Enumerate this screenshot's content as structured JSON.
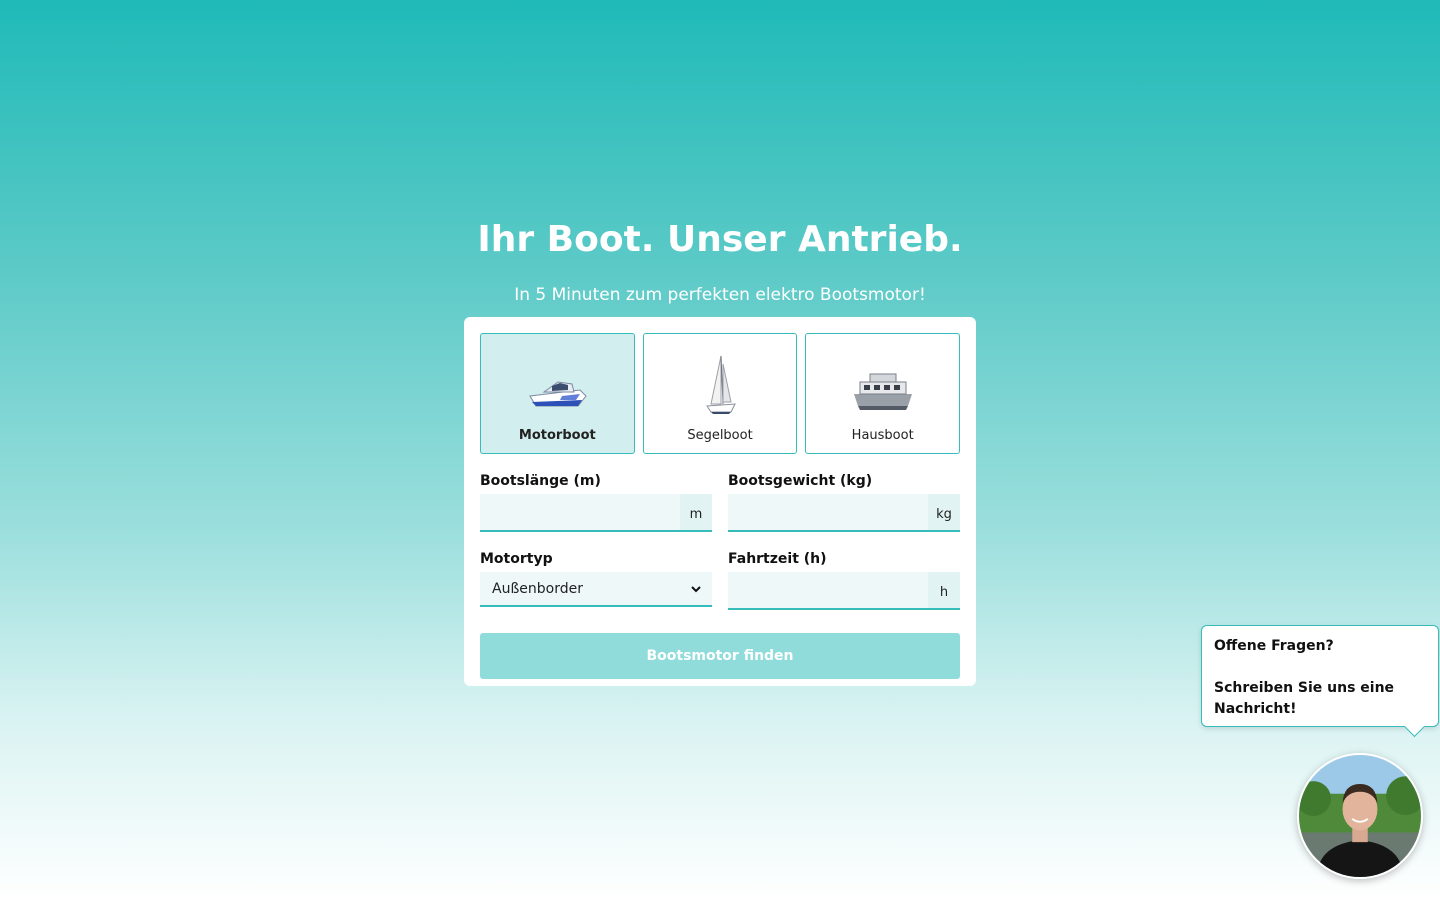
{
  "hero": {
    "title": "Ihr Boot. Unser Antrieb.",
    "subtitle": "In 5 Minuten zum perfekten elektro Bootsmotor!"
  },
  "boat_types": [
    {
      "label": "Motorboot",
      "selected": true,
      "icon": "motorboat-icon"
    },
    {
      "label": "Segelboot",
      "selected": false,
      "icon": "sailboat-icon"
    },
    {
      "label": "Hausboot",
      "selected": false,
      "icon": "houseboat-icon"
    }
  ],
  "form": {
    "length": {
      "label": "Bootslänge (m)",
      "value": "",
      "unit": "m"
    },
    "weight": {
      "label": "Bootsgewicht (kg)",
      "value": "",
      "unit": "kg"
    },
    "motor_type": {
      "label": "Motortyp",
      "selected": "Außenborder"
    },
    "duration": {
      "label": "Fahrtzeit (h)",
      "value": "",
      "unit": "h"
    },
    "submit_label": "Bootsmotor finden"
  },
  "chat": {
    "line1": "Offene Fragen?",
    "line2": "Schreiben Sie uns eine",
    "line3": "Nachricht!"
  },
  "colors": {
    "accent": "#36bcbb",
    "button": "#8fdcdb",
    "selected_bg": "#d3eeee"
  }
}
